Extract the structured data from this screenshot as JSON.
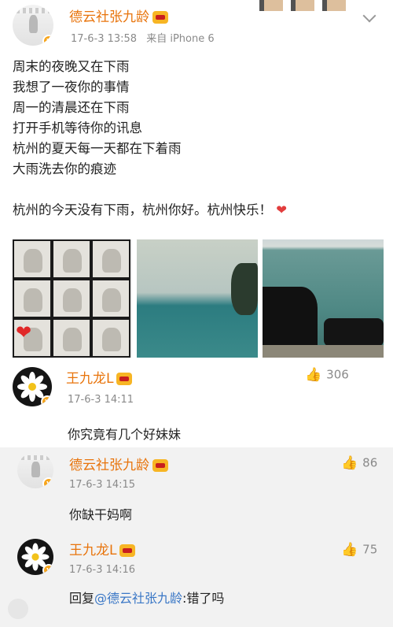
{
  "post": {
    "author": "德云社张九龄",
    "timestamp": "17-6-3 13:58",
    "source": "来自 iPhone 6",
    "lines": [
      "周末的夜晚又在下雨",
      "我想了一夜你的事情",
      "周一的清晨还在下雨",
      "打开手机等待你的讯息",
      "杭州的夏天每一天都在下着雨",
      "大雨洗去你的痕迹"
    ],
    "last_line": "杭州的今天没有下雨，杭州你好。杭州快乐！",
    "heart": "❤"
  },
  "comments": [
    {
      "author": "王九龙L",
      "timestamp": "17-6-3 14:11",
      "likes": "306",
      "text": "你究竟有几个好妹妹"
    }
  ],
  "replies": [
    {
      "author": "德云社张九龄",
      "timestamp": "17-6-3 14:15",
      "likes": "86",
      "text": "你缺干妈啊"
    },
    {
      "author": "王九龙L",
      "timestamp": "17-6-3 14:16",
      "likes": "75",
      "text_prefix": "回复",
      "mention": "@德云社张九龄",
      "text_suffix": ":错了吗"
    }
  ],
  "icons": {
    "like": "thumbs-up-icon",
    "verified": "verified-badge-icon",
    "vip": "vip-crown-icon",
    "more": "chevron-down-icon"
  },
  "colors": {
    "name": "#e8740c",
    "meta": "#8a8a8a",
    "mention": "#3a77c6",
    "reply_bg": "#f2f2f2"
  }
}
